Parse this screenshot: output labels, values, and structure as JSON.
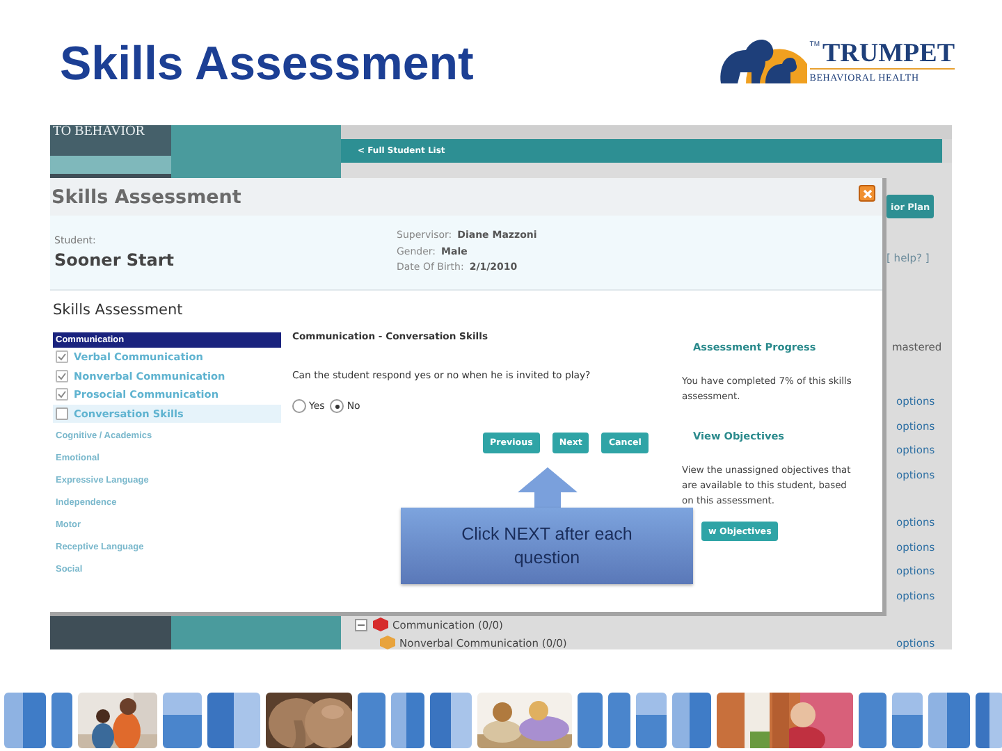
{
  "slide_title": "Skills Assessment",
  "logo": {
    "tm": "TM",
    "name": "TRUMPET",
    "tagline": "BEHAVIORAL HEALTH"
  },
  "background_page": {
    "brand_fragment": "TO BEHAVIOR",
    "back_link": "< Full Student List",
    "plan_button": "ior Plan",
    "help_link": "[ help? ]",
    "mastered_label": "mastered",
    "options_links": [
      "options",
      "options",
      "options",
      "options",
      "options",
      "options",
      "options",
      "options",
      "options"
    ],
    "tree": [
      {
        "label": "Communication (0/0)",
        "color": "#d62b2b",
        "expanded": true,
        "children": [
          {
            "label": "Nonverbal Communication (0/0)",
            "color": "#e8a33c"
          }
        ]
      }
    ]
  },
  "dialog": {
    "title": "Skills Assessment",
    "student_label": "Student:",
    "student_name": "Sooner Start",
    "details": [
      {
        "label": "Supervisor:",
        "value": "Diane Mazzoni"
      },
      {
        "label": "Gender:",
        "value": "Male"
      },
      {
        "label": "Date Of Birth:",
        "value": "2/1/2010"
      }
    ],
    "section_title": "Skills Assessment",
    "categories": [
      {
        "label": "Communication",
        "selected": true,
        "children": [
          {
            "label": "Verbal Communication",
            "checked": true,
            "selected": false
          },
          {
            "label": "Nonverbal Communication",
            "checked": true,
            "selected": false
          },
          {
            "label": "Prosocial Communication",
            "checked": true,
            "selected": false
          },
          {
            "label": "Conversation Skills",
            "checked": false,
            "selected": true
          }
        ]
      },
      {
        "label": "Cognitive / Academics",
        "selected": false
      },
      {
        "label": "Emotional",
        "selected": false
      },
      {
        "label": "Expressive Language",
        "selected": false
      },
      {
        "label": "Independence",
        "selected": false
      },
      {
        "label": "Motor",
        "selected": false
      },
      {
        "label": "Receptive Language",
        "selected": false
      },
      {
        "label": "Social",
        "selected": false
      }
    ],
    "question_title": "Communication - Conversation Skills",
    "question": "Can the student respond yes or no when he is invited to play?",
    "answers": [
      {
        "label": "Yes",
        "selected": false
      },
      {
        "label": "No",
        "selected": true
      }
    ],
    "buttons": [
      "Previous",
      "Next",
      "Cancel"
    ],
    "progress": {
      "title": "Assessment Progress",
      "text": "You have completed 7% of this skills assessment."
    },
    "objectives": {
      "title": "View Objectives",
      "text": "View the unassigned objectives that are available to this student, based on this assessment.",
      "button": "w Objectives"
    }
  },
  "callout": {
    "text": "Click NEXT after each question"
  }
}
